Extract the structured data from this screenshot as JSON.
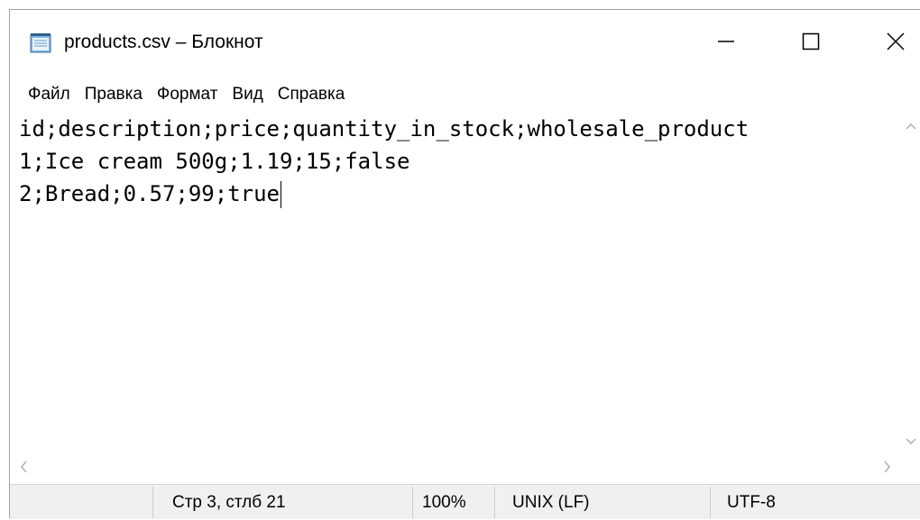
{
  "window": {
    "title": "products.csv – Блокнот",
    "icon": "notepad-icon",
    "controls": {
      "minimize": "minimize-icon",
      "maximize": "maximize-icon",
      "close": "close-icon"
    }
  },
  "menu": {
    "items": [
      {
        "label": "Файл"
      },
      {
        "label": "Правка"
      },
      {
        "label": "Формат"
      },
      {
        "label": "Вид"
      },
      {
        "label": "Справка"
      }
    ]
  },
  "editor": {
    "lines": [
      "id;description;price;quantity_in_stock;wholesale_product",
      "1;Ice cream 500g;1.19;15;false",
      "2;Bread;0.57;99;true"
    ]
  },
  "scrollbars": {
    "up_arrow": "^",
    "down_arrow": "v",
    "left_arrow": "<",
    "right_arrow": ">"
  },
  "status": {
    "position": "Стр 3, стлб 21",
    "zoom": "100%",
    "line_ending": "UNIX (LF)",
    "encoding": "UTF-8"
  },
  "colors": {
    "statusbar_bg": "#f0f0f0",
    "border": "#a0a0a0",
    "scroll_arrow": "#b0b0b0"
  }
}
